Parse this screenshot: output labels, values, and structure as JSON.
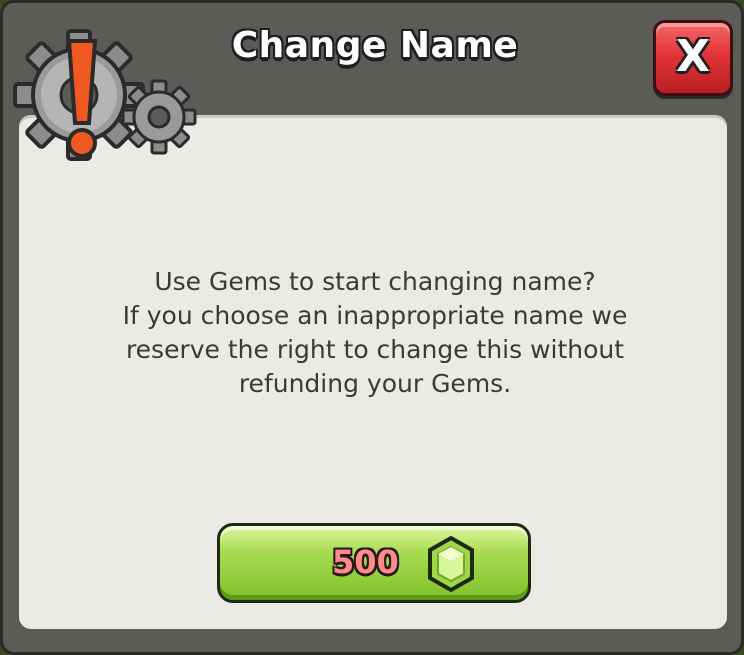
{
  "dialog": {
    "title": "Change Name",
    "close_label": "X",
    "message_lines": [
      "Use Gems to start changing name?",
      "If you choose an inappropriate name we",
      "reserve the right to change this without",
      "refunding your Gems."
    ],
    "buy_button": {
      "price": "500",
      "currency_icon": "gem-icon"
    },
    "header_icon": "gear-warning-icon"
  },
  "colors": {
    "frame": "#5b5b58",
    "panel": "#ebeae4",
    "close_red": "#e33438",
    "buy_green": "#a8dc52",
    "warning_orange": "#f05a22",
    "gem_green": "#b8e86a"
  }
}
